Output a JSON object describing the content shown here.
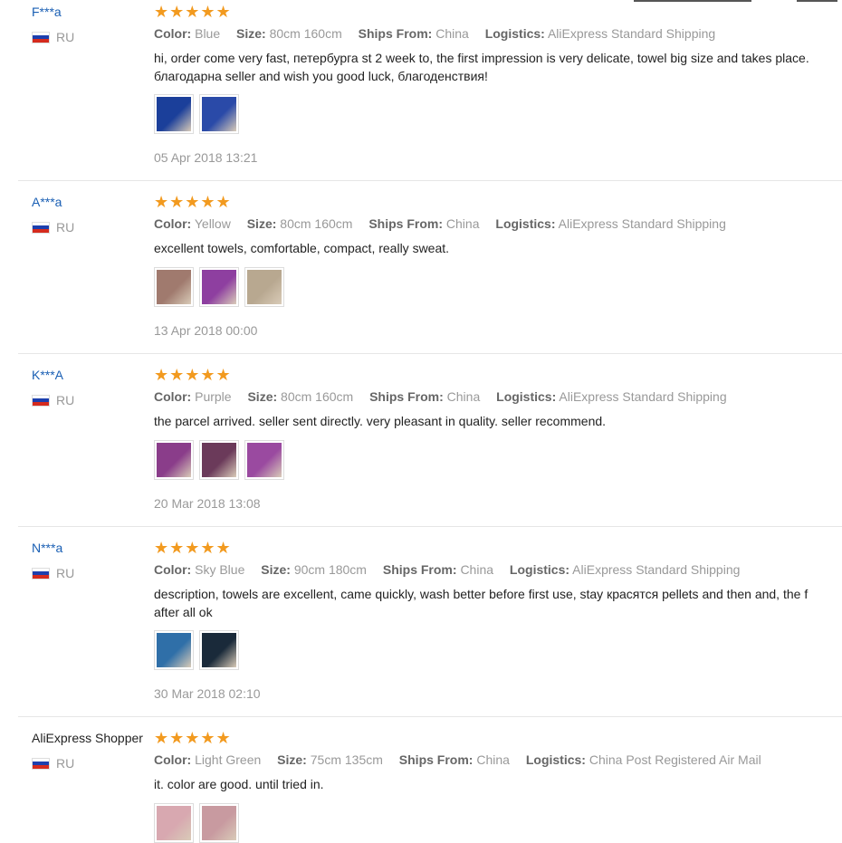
{
  "reviews": [
    {
      "user": "F***a",
      "country": "RU",
      "stars": "★★★★★",
      "color": "Blue",
      "size": "80cm 160cm",
      "ships_from": "China",
      "logistics": "AliExpress Standard Shipping",
      "text_line1": "hi, order come very fast, петербурга st 2 week to, the first impression is very delicate, towel big size and takes place.",
      "text_line2": "благодарна seller and wish you good luck, благоденствия!",
      "photos": [
        "#1b3f9a",
        "#2a4aa8"
      ],
      "date": "05 Apr 2018 13:21"
    },
    {
      "user": "A***a",
      "country": "RU",
      "stars": "★★★★★",
      "color": "Yellow",
      "size": "80cm 160cm",
      "ships_from": "China",
      "logistics": "AliExpress Standard Shipping",
      "text_line1": "excellent towels, comfortable, compact, really sweat.",
      "text_line2": "",
      "photos": [
        "#a07a6e",
        "#8e3fa0",
        "#b8a890"
      ],
      "date": "13 Apr 2018 00:00"
    },
    {
      "user": "K***A",
      "country": "RU",
      "stars": "★★★★★",
      "color": "Purple",
      "size": "80cm 160cm",
      "ships_from": "China",
      "logistics": "AliExpress Standard Shipping",
      "text_line1": "the parcel arrived. seller sent directly. very pleasant in quality. seller recommend.",
      "text_line2": "",
      "photos": [
        "#8a3d8a",
        "#6b3a5a",
        "#9a4aa0"
      ],
      "date": "20 Mar 2018 13:08"
    },
    {
      "user": "N***a",
      "country": "RU",
      "stars": "★★★★★",
      "color": "Sky Blue",
      "size": "90cm 180cm",
      "ships_from": "China",
      "logistics": "AliExpress Standard Shipping",
      "text_line1": "description, towels are excellent, came quickly, wash better before first use, stay красятся pellets and then and, the f",
      "text_line2": "after all ok",
      "photos": [
        "#2f6fa8",
        "#1a2a3a"
      ],
      "date": "30 Mar 2018 02:10"
    },
    {
      "user": "AliExpress Shopper",
      "country": "RU",
      "stars": "★★★★★",
      "color": "Light Green",
      "size": "75cm 135cm",
      "ships_from": "China",
      "logistics": "China Post Registered Air Mail",
      "text_line1": "it. color are good. until tried in.",
      "text_line2": "",
      "photos": [
        "#d8a8b0",
        "#c89aa0"
      ],
      "date": ""
    }
  ],
  "labels": {
    "color": "Color:",
    "size": "Size:",
    "ships_from": "Ships From:",
    "logistics": "Logistics:"
  },
  "colors": {
    "link": "#1a5fb4",
    "star": "#f29a1f",
    "muted": "#999999",
    "separator": "#e6e6e6"
  },
  "icons": {
    "flag": "russia-flag-icon",
    "star": "star-icon"
  }
}
